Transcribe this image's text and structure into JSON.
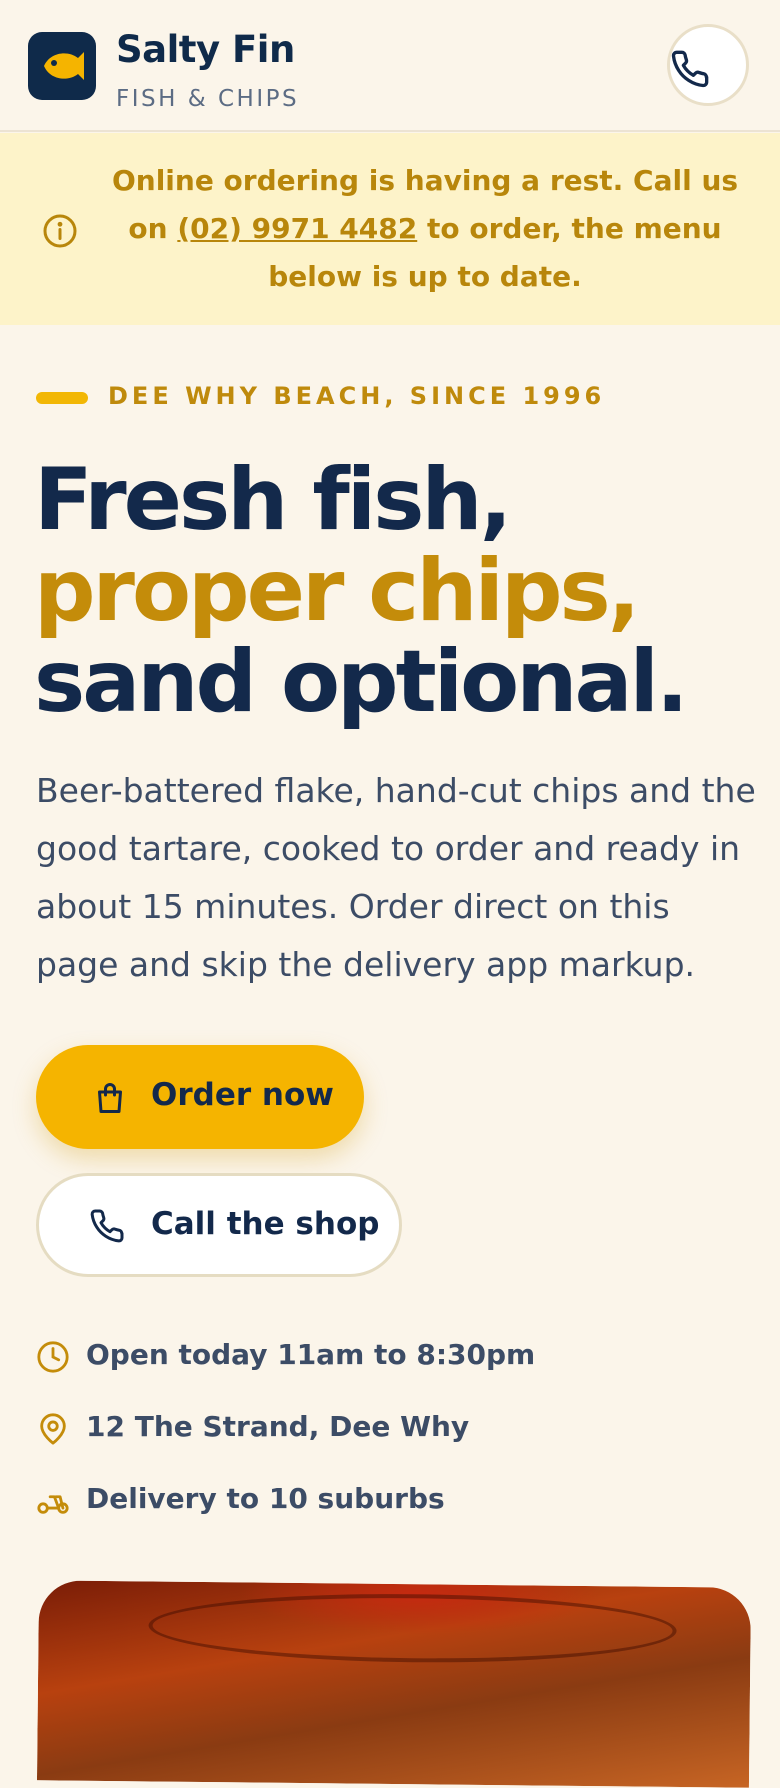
{
  "header": {
    "brand_name": "Salty Fin",
    "brand_sub": "FISH & CHIPS",
    "logo_icon": "fish-icon",
    "phone_icon": "phone-icon"
  },
  "banner": {
    "icon": "info-icon",
    "text_before": "Online ordering is having a rest. Call us on",
    "phone": "(02) 9971 4482",
    "text_after": "to order, the menu below is up to date."
  },
  "hero": {
    "eyebrow": "DEE WHY BEACH, SINCE 1996",
    "headline_line1": "Fresh fish,",
    "headline_line2": "proper chips,",
    "headline_line3": "sand optional.",
    "intro": "Beer-battered flake, hand-cut chips and the good tartare, cooked to order and ready in about 15 minutes. Order direct on this page and skip the delivery app markup."
  },
  "actions": {
    "order_label": "Order now",
    "order_icon": "shopping-bag-icon",
    "call_label": "Call the shop",
    "call_icon": "phone-icon"
  },
  "info": [
    {
      "icon": "clock-icon",
      "text": "Open today 11am to 8:30pm"
    },
    {
      "icon": "map-pin-icon",
      "text": "12 The Strand, Dee Why"
    },
    {
      "icon": "scooter-icon",
      "text": "Delivery to 10 suburbs"
    }
  ],
  "colors": {
    "navy": "#13294b",
    "gold": "#c48c0a",
    "accent": "#f5b400",
    "banner_bg": "#fdf3c9",
    "page_bg": "#fbf5ea"
  }
}
